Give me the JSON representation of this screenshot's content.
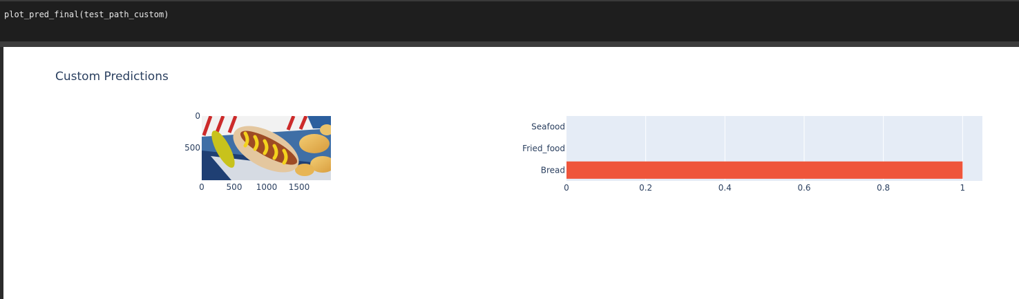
{
  "cell": {
    "code": "plot_pred_final(test_path_custom)"
  },
  "figure": {
    "title": "Custom Predictions"
  },
  "image_panel": {
    "content": "hot dog with mustard, pickle and potato chips in a paper tray",
    "x_ticks": [
      "0",
      "500",
      "1000",
      "1500"
    ],
    "y_ticks": [
      "0",
      "500"
    ]
  },
  "chart_data": {
    "type": "bar",
    "orientation": "horizontal",
    "categories": [
      "Seafood",
      "Fried_food",
      "Bread"
    ],
    "values": [
      0,
      0,
      1
    ],
    "bar_color": "#EF553B",
    "plot_bg": "#E5ECF6",
    "xlim": [
      0,
      1.05
    ],
    "x_ticks": [
      "0",
      "0.2",
      "0.4",
      "0.6",
      "0.8",
      "1"
    ],
    "grid": true
  }
}
